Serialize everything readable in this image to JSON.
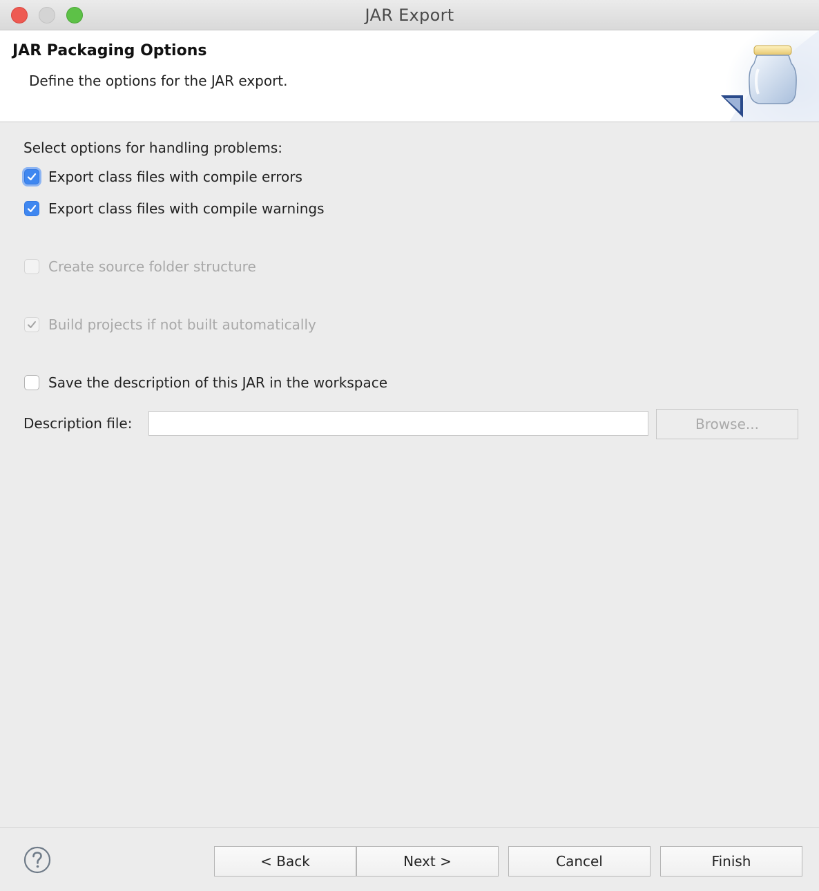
{
  "window": {
    "title": "JAR Export"
  },
  "banner": {
    "title": "JAR Packaging Options",
    "subtitle": "Define the options for the JAR export.",
    "icon": "jar-icon"
  },
  "problems": {
    "label": "Select options for handling problems:",
    "options": [
      {
        "label": "Export class files with compile errors",
        "checked": true,
        "enabled": true,
        "focused": true
      },
      {
        "label": "Export class files with compile warnings",
        "checked": true,
        "enabled": true,
        "focused": false
      }
    ]
  },
  "source_folder": {
    "label": "Create source folder structure",
    "checked": false,
    "enabled": false
  },
  "build_projects": {
    "label": "Build projects if not built automatically",
    "checked": true,
    "enabled": false
  },
  "save_description": {
    "label": "Save the description of this JAR in the workspace",
    "checked": false,
    "enabled": true
  },
  "description_file": {
    "label": "Description file:",
    "value": "",
    "browse_label": "Browse..."
  },
  "footer": {
    "help_icon": "question-mark-icon",
    "back_label": "< Back",
    "next_label": "Next >",
    "cancel_label": "Cancel",
    "finish_label": "Finish"
  },
  "colors": {
    "accent": "#3f87f0",
    "close": "#ee5a52",
    "maximize": "#5dc147"
  }
}
